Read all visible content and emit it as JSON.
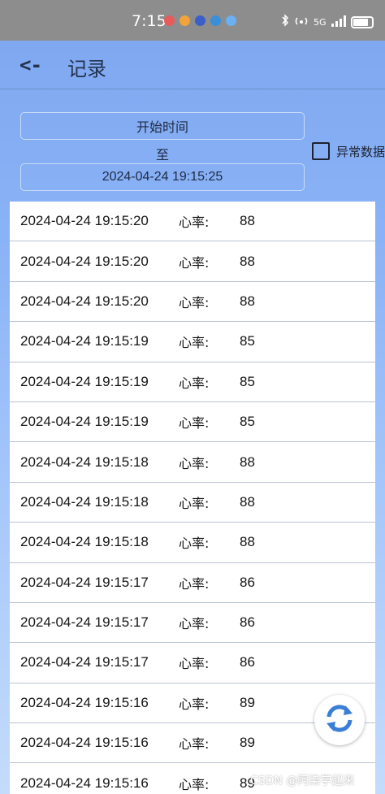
{
  "statusbar": {
    "time": "7:15",
    "network": "5G",
    "left_icons": [
      {
        "name": "notification-red-icon",
        "color": "#e85b5b"
      },
      {
        "name": "notification-orange-icon",
        "color": "#f0a43a"
      },
      {
        "name": "notification-blue-icon",
        "color": "#3b5ec9"
      },
      {
        "name": "notification-shield-icon",
        "color": "#3a8fd8"
      },
      {
        "name": "cloud-icon",
        "color": "#6ab0f2"
      }
    ]
  },
  "header": {
    "back_glyph": "<-",
    "title": "记录"
  },
  "filter": {
    "start_label": "开始时间",
    "to_label": "至",
    "end_value": "2024-04-24 19:15:25",
    "abnormal_label": "异常数据"
  },
  "records": [
    {
      "time": "2024-04-24 19:15:20",
      "label": "心率:",
      "value": "88"
    },
    {
      "time": "2024-04-24 19:15:20",
      "label": "心率:",
      "value": "88"
    },
    {
      "time": "2024-04-24 19:15:20",
      "label": "心率:",
      "value": "88"
    },
    {
      "time": "2024-04-24 19:15:19",
      "label": "心率:",
      "value": "85"
    },
    {
      "time": "2024-04-24 19:15:19",
      "label": "心率:",
      "value": "85"
    },
    {
      "time": "2024-04-24 19:15:19",
      "label": "心率:",
      "value": "85"
    },
    {
      "time": "2024-04-24 19:15:18",
      "label": "心率:",
      "value": "88"
    },
    {
      "time": "2024-04-24 19:15:18",
      "label": "心率:",
      "value": "88"
    },
    {
      "time": "2024-04-24 19:15:18",
      "label": "心率:",
      "value": "88"
    },
    {
      "time": "2024-04-24 19:15:17",
      "label": "心率:",
      "value": "86"
    },
    {
      "time": "2024-04-24 19:15:17",
      "label": "心率:",
      "value": "86"
    },
    {
      "time": "2024-04-24 19:15:17",
      "label": "心率:",
      "value": "86"
    },
    {
      "time": "2024-04-24 19:15:16",
      "label": "心率:",
      "value": "89"
    },
    {
      "time": "2024-04-24 19:15:16",
      "label": "心率:",
      "value": "89"
    },
    {
      "time": "2024-04-24 19:15:16",
      "label": "心率:",
      "value": "89"
    }
  ],
  "fab": {
    "icon": "refresh-icon"
  },
  "watermark": "CSDN @阿柒学起来",
  "colors": {
    "background_top": "#7fa8f1",
    "background_bottom": "#c4dcfb",
    "refresh_blue": "#3a7fd5"
  }
}
